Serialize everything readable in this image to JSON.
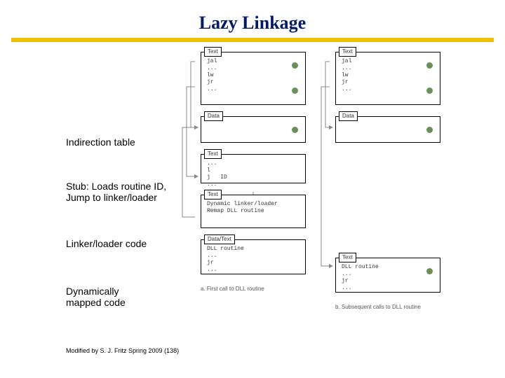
{
  "title": "Lazy Linkage",
  "labels": {
    "indirection": "Indirection table",
    "stub": "Stub: Loads routine ID,\nJump to linker/loader",
    "linker": "Linker/loader code",
    "dynmap": "Dynamically\nmapped code"
  },
  "footer": "Modified by S. J. Fritz  Spring 2009 (138)",
  "col_a": {
    "caption": "a. First call to DLL routine",
    "text_box": {
      "header": "Text",
      "body": "jal\n...\nlw\njr\n..."
    },
    "data_box": {
      "header": "Data",
      "body": " "
    },
    "stub_box": {
      "header": "Text",
      "body": "...\nl\nj   ID\n..."
    },
    "loader_box": {
      "header": "Text",
      "body": "Dynamic linker/loader\nRemap DLL routine"
    },
    "dll_box": {
      "header": "Data/Text",
      "body": "DLL routine\n...\njr\n..."
    }
  },
  "col_b": {
    "caption": "b. Subsequent calls to DLL routine",
    "text_box": {
      "header": "Text",
      "body": "jal\n...\nlw\njr\n..."
    },
    "data_box": {
      "header": "Data",
      "body": " "
    },
    "dll_box": {
      "header": "Text",
      "body": "DLL routine\n...\njr\n..."
    }
  }
}
